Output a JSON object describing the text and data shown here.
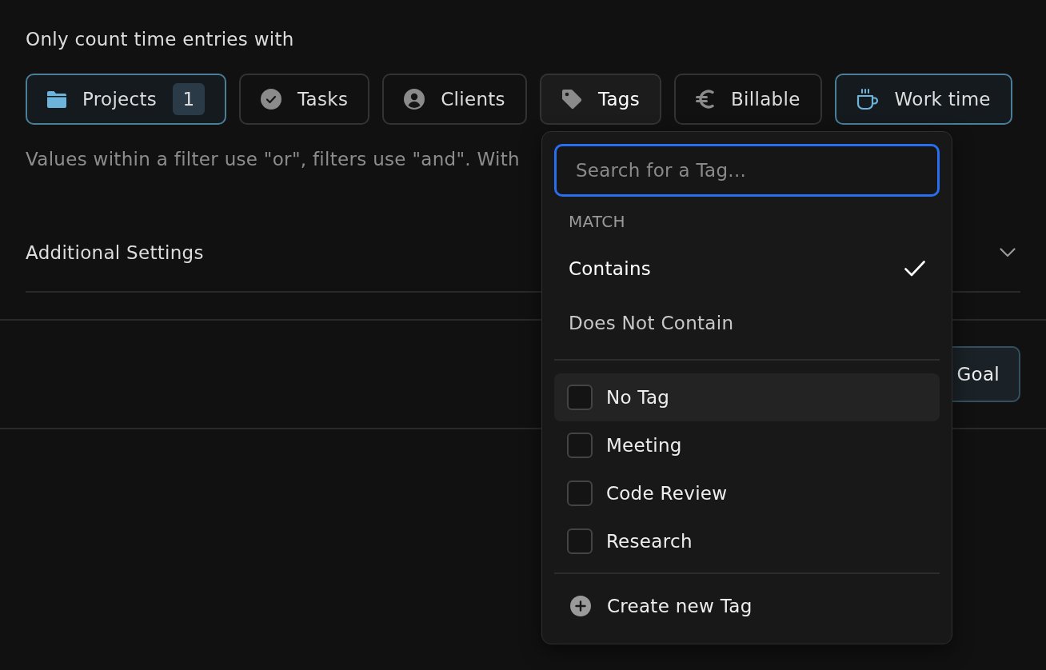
{
  "filters": {
    "heading": "Only count time entries with",
    "chips": [
      {
        "label": "Projects",
        "active": true,
        "open": false,
        "count": "1"
      },
      {
        "label": "Tasks",
        "active": false,
        "open": false
      },
      {
        "label": "Clients",
        "active": false,
        "open": false
      },
      {
        "label": "Tags",
        "active": false,
        "open": true
      },
      {
        "label": "Billable",
        "active": false,
        "open": false
      },
      {
        "label": "Work time",
        "active": true,
        "open": false
      }
    ],
    "hint": "Values within a filter use \"or\", filters use \"and\". With"
  },
  "additional_settings": {
    "label": "Additional Settings",
    "expanded": false
  },
  "footer": {
    "button": "Goal"
  },
  "tag_dropdown": {
    "search": {
      "placeholder": "Search for a Tag..."
    },
    "match_label": "MATCH",
    "match_options": [
      {
        "label": "Contains",
        "selected": true
      },
      {
        "label": "Does Not Contain",
        "selected": false
      }
    ],
    "tags": [
      {
        "label": "No Tag",
        "checked": false,
        "highlighted": true
      },
      {
        "label": "Meeting",
        "checked": false,
        "highlighted": false
      },
      {
        "label": "Code Review",
        "checked": false,
        "highlighted": false
      },
      {
        "label": "Research",
        "checked": false,
        "highlighted": false
      }
    ],
    "create_label": "Create new Tag"
  }
}
